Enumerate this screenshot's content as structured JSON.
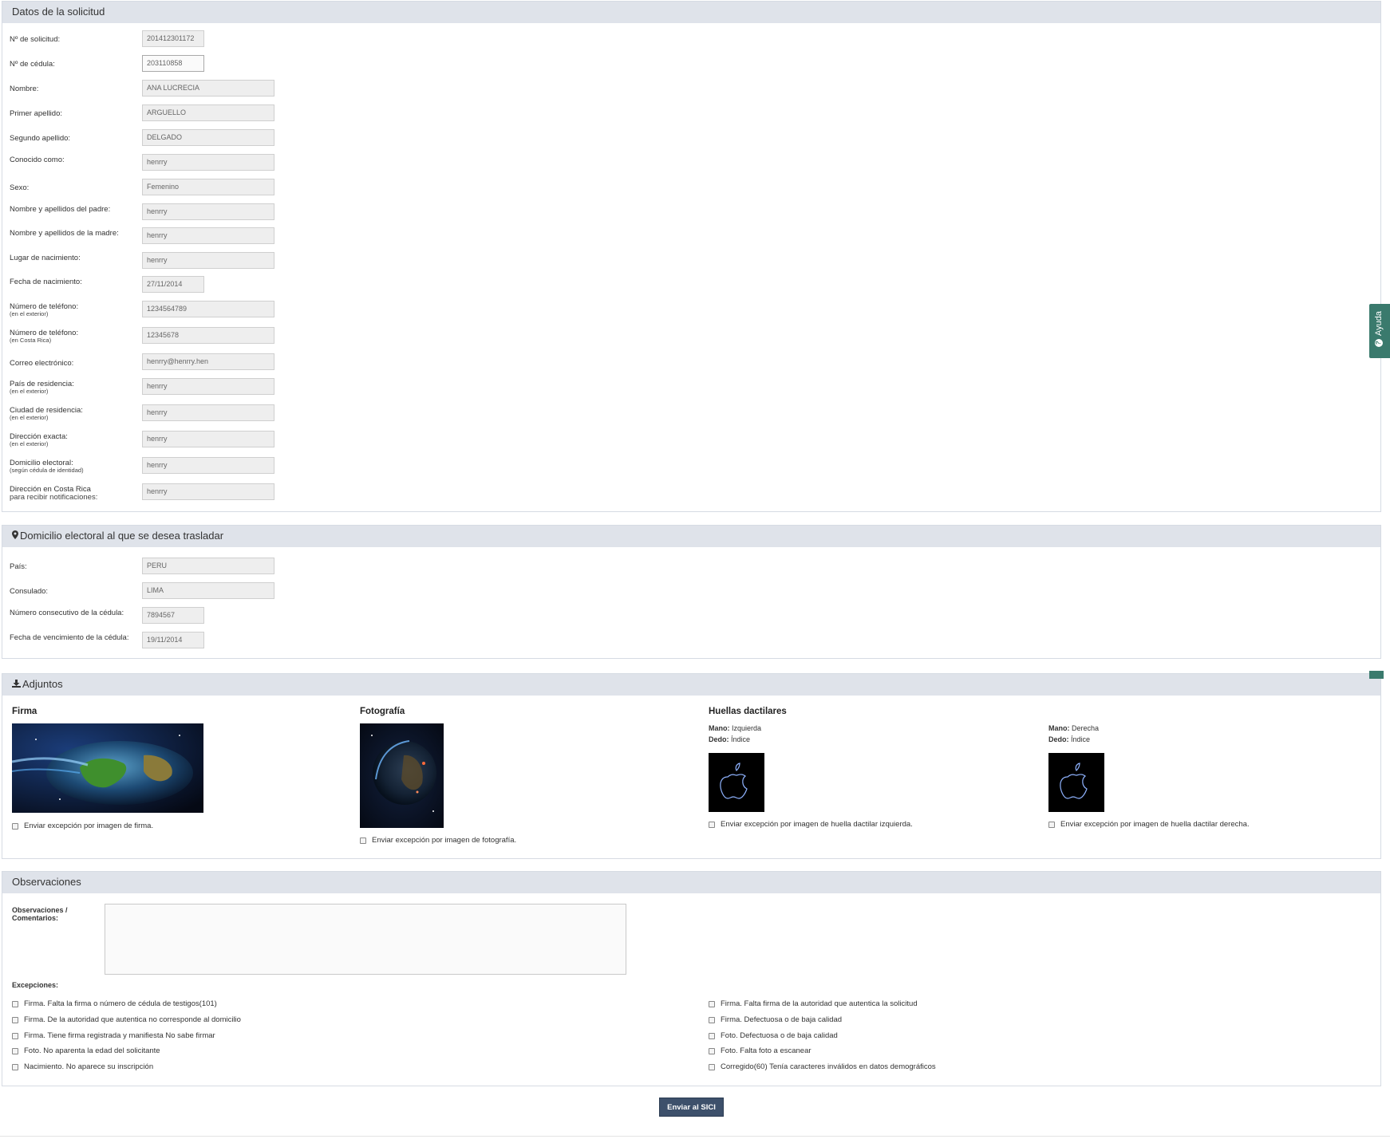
{
  "solicitud": {
    "title": "Datos de la solicitud",
    "fields": [
      {
        "label": "Nº de solicitud:",
        "sub": "",
        "value": "201412301172"
      },
      {
        "label": "Nº de cédula:",
        "sub": "",
        "value": "203110858"
      },
      {
        "label": "Nombre:",
        "sub": "",
        "value": "ANA LUCRECIA"
      },
      {
        "label": "Primer apellido:",
        "sub": "",
        "value": "ARGUELLO"
      },
      {
        "label": "Segundo apellido:",
        "sub": "",
        "value": "DELGADO"
      },
      {
        "label": "Conocido como:",
        "sub": "",
        "value": "henrry"
      },
      {
        "label": "Sexo:",
        "sub": "",
        "value": "Femenino"
      },
      {
        "label": "Nombre y apellidos del padre:",
        "sub": "",
        "value": "henrry"
      },
      {
        "label": "Nombre y apellidos de la madre:",
        "sub": "",
        "value": "henrry"
      },
      {
        "label": "Lugar de nacimiento:",
        "sub": "",
        "value": "henrry"
      },
      {
        "label": "Fecha de nacimiento:",
        "sub": "",
        "value": "27/11/2014"
      },
      {
        "label": "Número de teléfono:",
        "sub": "(en el exterior)",
        "value": "1234564789"
      },
      {
        "label": "Número de teléfono:",
        "sub": "(en Costa Rica)",
        "value": "12345678"
      },
      {
        "label": "Correo electrónico:",
        "sub": "",
        "value": "henrry@henrry.hen"
      },
      {
        "label": "País de residencia:",
        "sub": "(en el exterior)",
        "value": "henrry"
      },
      {
        "label": "Ciudad de residencia:",
        "sub": "(en el exterior)",
        "value": "henrry"
      },
      {
        "label": "Dirección exacta:",
        "sub": "(en el exterior)",
        "value": "henrry"
      },
      {
        "label": "Domicilio electoral:",
        "sub": "(según cédula de identidad)",
        "value": "henrry"
      },
      {
        "label": "Dirección en Costa Rica",
        "sub": "para recibir notificaciones:",
        "value": "henrry"
      }
    ]
  },
  "domicilio": {
    "title": "Domicilio electoral al que se desea trasladar",
    "icon": "map-marker-icon",
    "fields": [
      {
        "label": "País:",
        "value": "PERU"
      },
      {
        "label": "Consulado:",
        "value": "LIMA"
      },
      {
        "label": "Número consecutivo de la cédula:",
        "value": "7894567"
      },
      {
        "label": "Fecha de vencimiento de la cédula:",
        "value": "19/11/2014"
      }
    ]
  },
  "adjuntos": {
    "title": "Adjuntos",
    "icon": "download-icon",
    "firma": {
      "title": "Firma",
      "exception": "Enviar excepción por imagen de firma."
    },
    "foto": {
      "title": "Fotografía",
      "exception": "Enviar excepción por imagen de fotografía."
    },
    "huellas": {
      "title": "Huellas dactilares",
      "mano_label": "Mano:",
      "dedo_label": "Dedo:",
      "left": {
        "mano": "Izquierda",
        "dedo": "Índice",
        "exception": "Enviar excepción por imagen de huella dactilar izquierda."
      },
      "right": {
        "mano": "Derecha",
        "dedo": "Índice",
        "exception": "Enviar excepción por imagen de huella dactilar derecha."
      }
    }
  },
  "observaciones": {
    "title": "Observaciones",
    "label_line1": "Observaciones /",
    "label_line2": "Comentarios:",
    "textarea_value": "",
    "excepciones_label": "Excepciones:",
    "left_items": [
      "Firma. Falta la firma o número de cédula de testigos(101)",
      "Firma. De la autoridad que autentica no corresponde al domicilio",
      "Firma. Tiene firma registrada y manifiesta No sabe firmar",
      "Foto. No aparenta la edad del solicitante",
      "Nacimiento. No aparece su inscripción"
    ],
    "right_items": [
      "Firma. Falta firma de la autoridad que autentica la solicitud",
      "Firma. Defectuosa o de baja calidad",
      "Foto. Defectuosa o de baja calidad",
      "Foto. Falta foto a escanear",
      "Corregido(60) Tenía caracteres inválidos en datos demográficos"
    ]
  },
  "actions": {
    "submit_label": "Enviar al SICI"
  },
  "help": {
    "label": "Ayuda",
    "icon": "question-circle-icon"
  },
  "colors": {
    "accent": "#3a7a6d",
    "button": "#3d506b",
    "header_bg": "#dfe3ea"
  }
}
